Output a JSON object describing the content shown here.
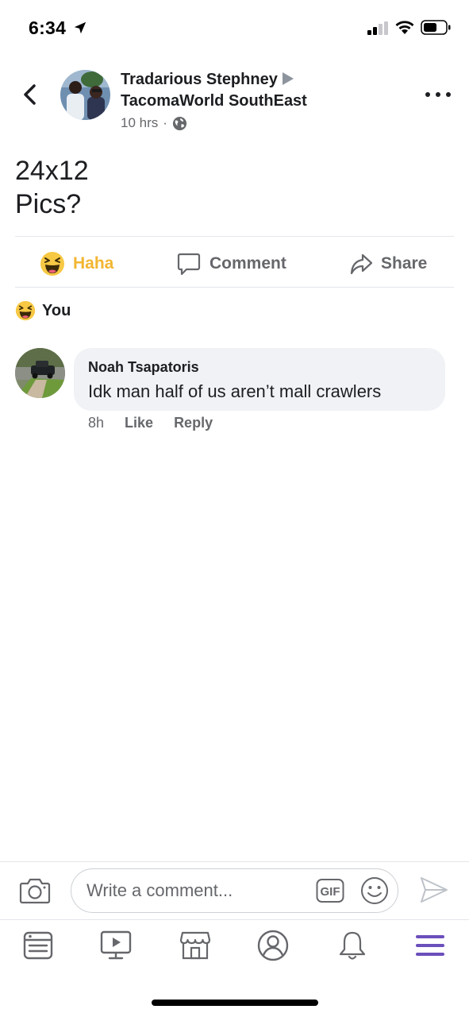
{
  "status_bar": {
    "time": "6:34"
  },
  "post": {
    "author": "Tradarious Stephney",
    "group": "TacomaWorld SouthEast",
    "time": "10 hrs",
    "separator": "·",
    "text_lines": [
      "24x12",
      "Pics?"
    ]
  },
  "actions": {
    "haha_label": "Haha",
    "comment_label": "Comment",
    "share_label": "Share"
  },
  "reactions": {
    "summary": "You"
  },
  "comments": [
    {
      "author": "Noah Tsapatoris",
      "text": "Idk man half of us aren’t mall crawlers",
      "time": "8h",
      "like_label": "Like",
      "reply_label": "Reply"
    }
  ],
  "composer": {
    "placeholder": "Write a comment...",
    "gif_label": "GIF"
  },
  "tabs": [
    "news-feed",
    "watch",
    "marketplace",
    "profile",
    "notifications",
    "menu"
  ],
  "colors": {
    "haha": "#f2b631",
    "secondary_text": "#65676b",
    "bubble": "#f0f2f5",
    "menu_active": "#6b4fbb"
  }
}
